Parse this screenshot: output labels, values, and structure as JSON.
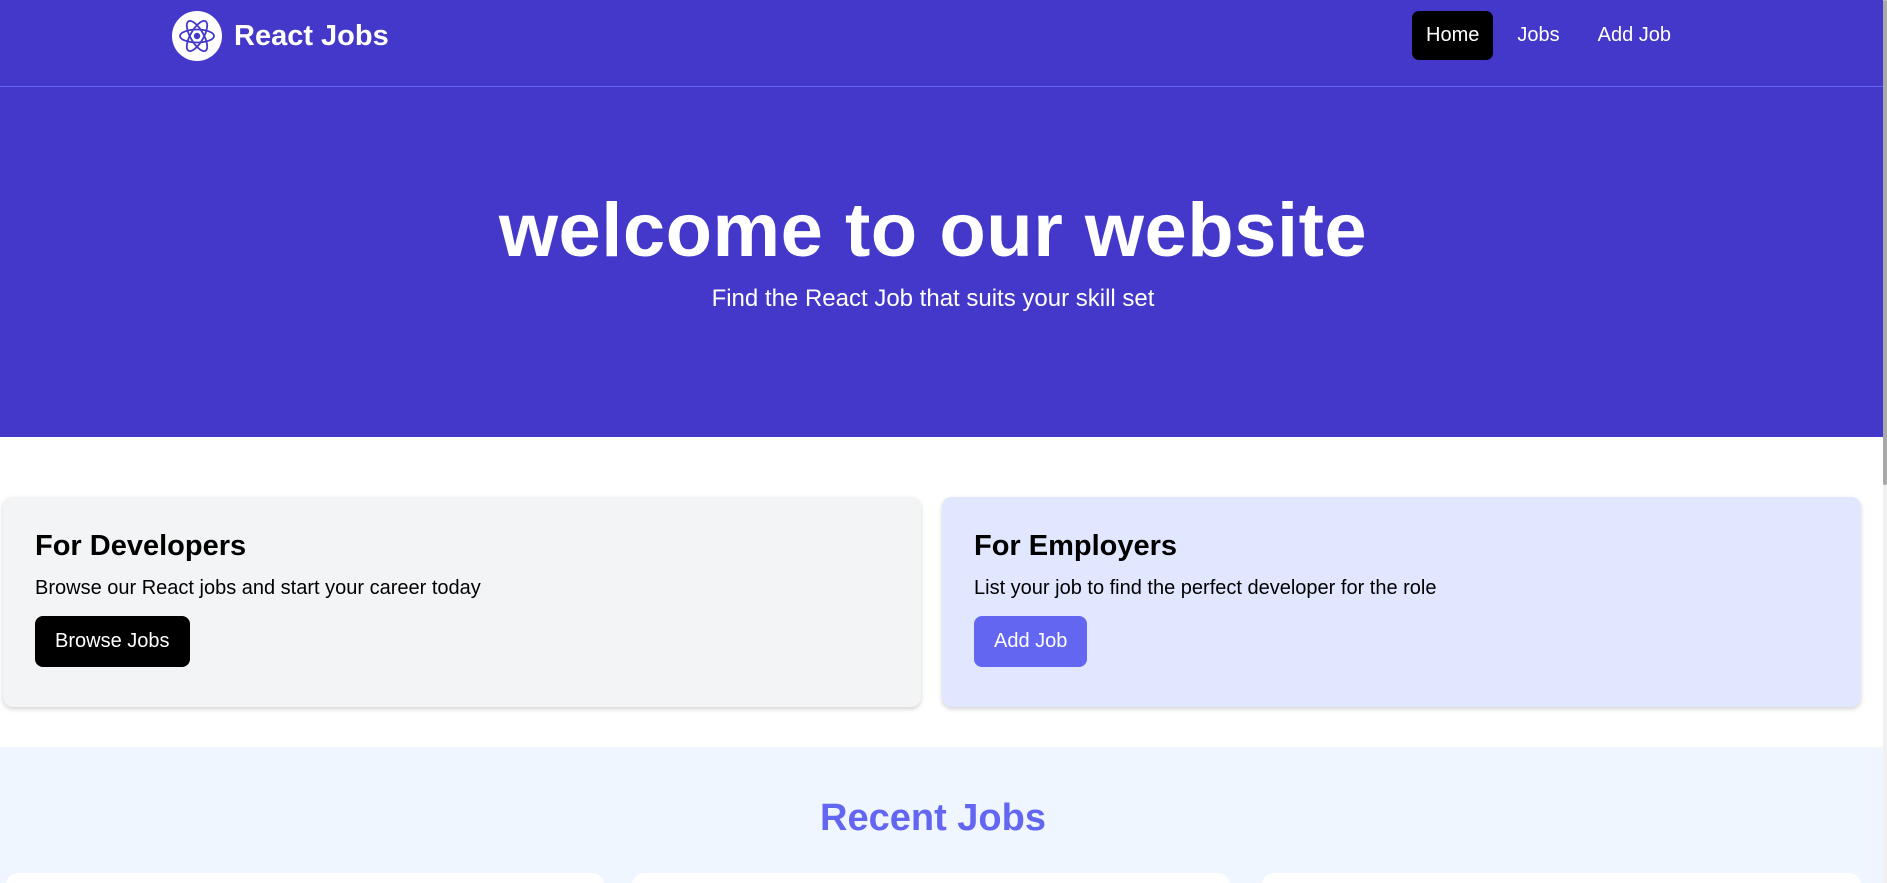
{
  "navbar": {
    "brand": "React Jobs",
    "brand_icon": "react-atom-icon",
    "links": [
      {
        "label": "Home",
        "active": true
      },
      {
        "label": "Jobs",
        "active": false
      },
      {
        "label": "Add Job",
        "active": false
      }
    ]
  },
  "hero": {
    "title": "welcome to our website",
    "subtitle": "Find the React Job that suits your skill set"
  },
  "cards": {
    "developers": {
      "title": "For Developers",
      "text": "Browse our React jobs and start your career today",
      "button": "Browse Jobs"
    },
    "employers": {
      "title": "For Employers",
      "text": "List your job to find the perfect developer for the role",
      "button": "Add Job"
    }
  },
  "recent_jobs": {
    "title": "Recent Jobs"
  },
  "colors": {
    "primary": "#4338ca",
    "accent": "#6366f1",
    "developer_card_bg": "#f3f4f6",
    "employer_card_bg": "#e0e7ff",
    "recent_bg": "#eff6ff"
  }
}
